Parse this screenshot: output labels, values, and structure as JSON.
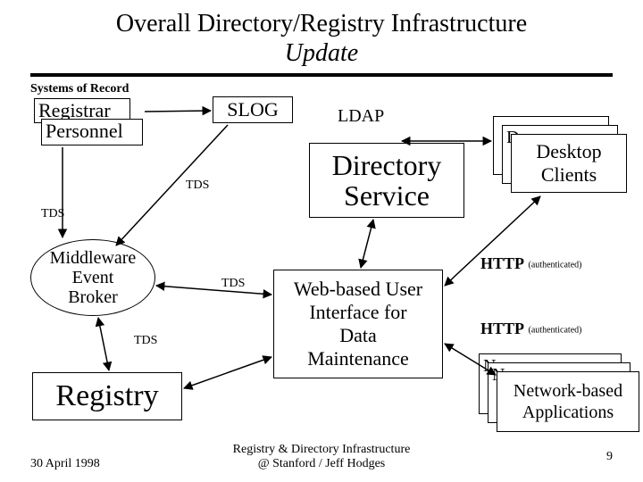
{
  "title_l1": "Overall Directory/Registry Infrastructure",
  "title_l2": "Update",
  "systems_of_record_label": "Systems of Record",
  "sor": {
    "registrar": "Registrar",
    "personnel": "Personnel"
  },
  "slog": "SLOG",
  "tds": "TDS",
  "ldap": "LDAP",
  "middleware": {
    "l1": "Middleware",
    "l2": "Event",
    "l3": "Broker"
  },
  "registry": "Registry",
  "directory_service": {
    "l1": "Directory",
    "l2": "Service"
  },
  "web_ui": {
    "l1": "Web-based User",
    "l2": "Interface for",
    "l3": "Data",
    "l4": "Maintenance"
  },
  "desktop": {
    "prefix": "D",
    "l1": "Desktop",
    "l2": "Clients"
  },
  "netapps": {
    "prefix": "N",
    "l1": "Network-based",
    "l2": "Applications"
  },
  "http": "HTTP",
  "authenticated": "(authenticated)",
  "footer": {
    "date": "30 April 1998",
    "center_l1": "Registry & Directory Infrastructure",
    "center_l2": "@ Stanford / Jeff Hodges",
    "page": "9"
  },
  "chart_data": {
    "type": "diagram",
    "title": "Overall Directory/Registry Infrastructure Update",
    "nodes": [
      {
        "id": "registrar",
        "label": "Registrar",
        "group": "Systems of Record"
      },
      {
        "id": "personnel",
        "label": "Personnel",
        "group": "Systems of Record"
      },
      {
        "id": "slog",
        "label": "SLOG"
      },
      {
        "id": "middleware",
        "label": "Middleware Event Broker"
      },
      {
        "id": "registry",
        "label": "Registry"
      },
      {
        "id": "directory_service",
        "label": "Directory Service"
      },
      {
        "id": "web_ui",
        "label": "Web-based User Interface for Data Maintenance"
      },
      {
        "id": "desktop_clients",
        "label": "Desktop Clients",
        "stacked": true
      },
      {
        "id": "network_apps",
        "label": "Network-based Applications",
        "stacked": true
      }
    ],
    "edges": [
      {
        "from": "personnel",
        "to": "slog",
        "label": ""
      },
      {
        "from": "slog",
        "to": "middleware",
        "label": "TDS",
        "bidirectional": false
      },
      {
        "from": "registrar",
        "to": "middleware",
        "label": "TDS",
        "bidirectional": false
      },
      {
        "from": "middleware",
        "to": "registry",
        "label": "TDS",
        "bidirectional": true
      },
      {
        "from": "middleware",
        "to": "web_ui",
        "label": "TDS",
        "bidirectional": true
      },
      {
        "from": "registry",
        "to": "web_ui",
        "label": "",
        "bidirectional": true
      },
      {
        "from": "directory_service",
        "to": "desktop_clients",
        "label": "LDAP",
        "bidirectional": true
      },
      {
        "from": "directory_service",
        "to": "web_ui",
        "label": "",
        "bidirectional": true
      },
      {
        "from": "web_ui",
        "to": "desktop_clients",
        "label": "HTTP (authenticated)",
        "bidirectional": true
      },
      {
        "from": "web_ui",
        "to": "network_apps",
        "label": "HTTP (authenticated)",
        "bidirectional": true
      }
    ]
  }
}
